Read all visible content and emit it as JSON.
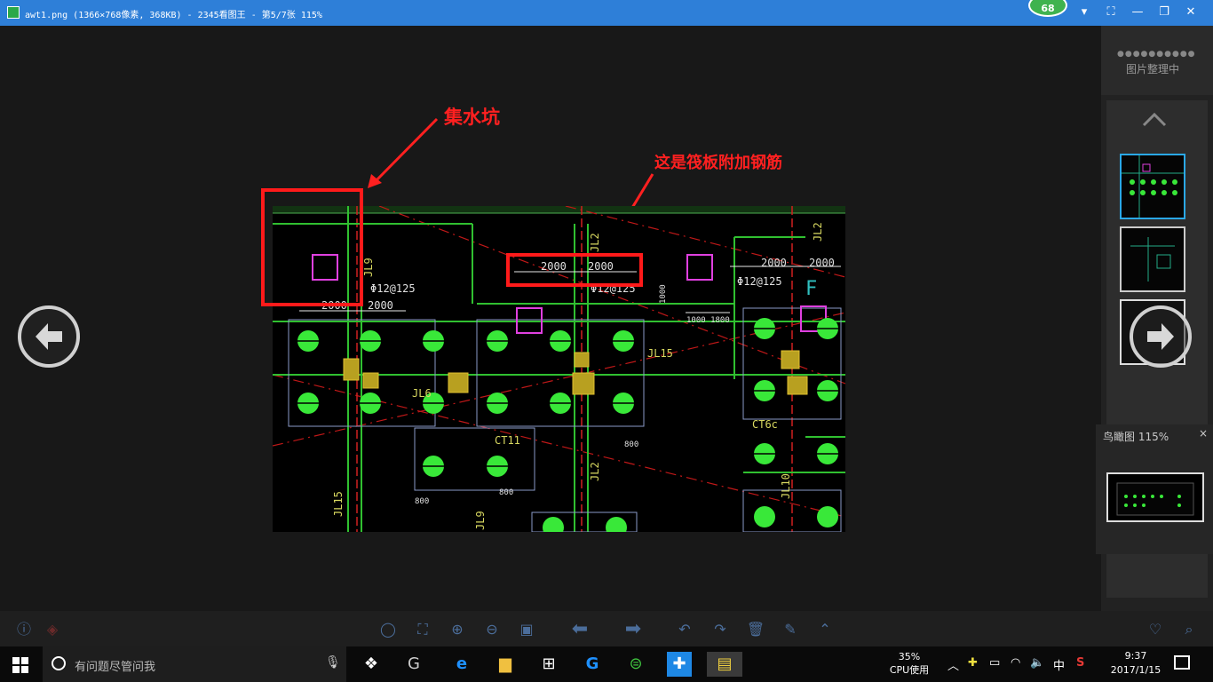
{
  "window": {
    "title": "awt1.png (1366×768像素, 368KB) - 2345看图王 - 第5/7张 115%",
    "badge": "68",
    "controls": [
      "▾",
      "⛶",
      "—",
      "❐",
      "✕"
    ]
  },
  "annotations": {
    "sump_label": "集水坑",
    "rebar_label": "这是筏板附加钢筋"
  },
  "drawing_labels": {
    "dim_2000_a": "2000",
    "dim_2000_b": "2000",
    "dim_2000_c": "2000",
    "dim_2000_d": "2000",
    "dim_2000_e": "2000",
    "dim_2000_f": "2000",
    "rebar_1": "Φ12@125",
    "rebar_2": "Φ12@125",
    "rebar_3": "Φ12@125",
    "jl9": "JL9",
    "jl2": "JL2",
    "jl15": "JL15",
    "jl6": "JL6",
    "ct11": "CT11",
    "ct6": "CT6c",
    "jl10": "JL10",
    "dim_1000_1800": "1000 1800",
    "dim_800": "800",
    "dim_1000": "1000",
    "fl": "F"
  },
  "sidebar": {
    "status": "图片整理中",
    "progress_dots": "●●●●●●●●●●"
  },
  "birdview": {
    "label": "鸟瞰图 115%",
    "close": "×"
  },
  "taskbar": {
    "search_placeholder": "有问题尽管问我",
    "cpu_percent": "35%",
    "cpu_label": "CPU使用",
    "ime": "中",
    "time": "9:37",
    "date": "2017/1/15"
  }
}
